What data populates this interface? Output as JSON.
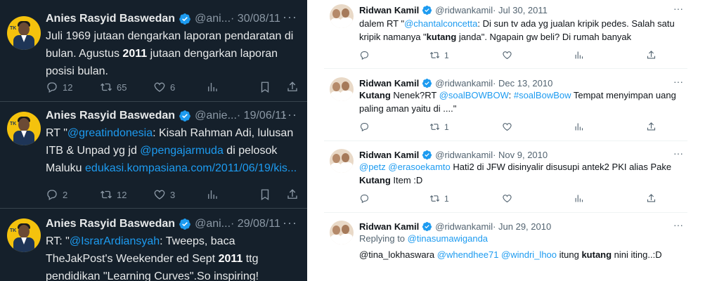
{
  "colors": {
    "dark_bg": "#15202b",
    "light_bg": "#ffffff",
    "link": "#1d9bf0",
    "verified": "#1d9bf0"
  },
  "left": {
    "tweets": [
      {
        "name": "Anies Rasyid Baswedan",
        "handle": "@ani...",
        "date": "· 30/08/11",
        "text": [
          {
            "t": "Juli 1969 jutaan dengarkan laporan pendaratan di bulan. Agustus "
          },
          {
            "t": "2011",
            "b": true
          },
          {
            "t": " jutaan dengarkan laporan posisi bulan."
          }
        ],
        "replies": "12",
        "retweets": "65",
        "likes": "6"
      },
      {
        "name": "Anies Rasyid Baswedan",
        "handle": "@anie...",
        "date": "· 19/06/11",
        "text": [
          {
            "t": "RT \""
          },
          {
            "t": "@greatindonesia",
            "l": true
          },
          {
            "t": ": Kisah Rahman Adi, lulusan ITB & Unpad yg jd "
          },
          {
            "t": "@pengajarmuda",
            "l": true
          },
          {
            "t": " di pelosok Maluku "
          },
          {
            "t": "edukasi.kompasiana.com/2011/06/19/kis...",
            "l": true
          }
        ],
        "replies": "2",
        "retweets": "12",
        "likes": "3"
      },
      {
        "name": "Anies Rasyid Baswedan",
        "handle": "@ani...",
        "date": "· 29/08/11",
        "text": [
          {
            "t": "RT: \""
          },
          {
            "t": "@IsrarArdiansyah",
            "l": true
          },
          {
            "t": ": Tweeps, baca TheJakPost's Weekender ed Sept "
          },
          {
            "t": "2011",
            "b": true
          },
          {
            "t": " ttg pendidikan \"Learning Curves\".So inspiring!"
          }
        ]
      }
    ]
  },
  "right": {
    "tweets": [
      {
        "name": "Ridwan Kamil",
        "handle": "@ridwankamil",
        "date": "· Jul 30, 2011",
        "text": [
          {
            "t": "dalem RT \""
          },
          {
            "t": "@chantalconcetta",
            "l": true
          },
          {
            "t": ": Di sun tv ada yg jualan kripik pedes. Salah satu kripik namanya \""
          },
          {
            "t": "kutang",
            "b": true
          },
          {
            "t": " janda\". Ngapain gw beli? Di rumah banyak"
          }
        ],
        "replies": "",
        "retweets": "1",
        "likes": ""
      },
      {
        "name": "Ridwan Kamil",
        "handle": "@ridwankamil",
        "date": "· Dec 13, 2010",
        "text": [
          {
            "t": "Kutang",
            "b": true
          },
          {
            "t": " Nenek?RT "
          },
          {
            "t": "@soalBOWBOW",
            "l": true
          },
          {
            "t": ": "
          },
          {
            "t": "#soalBowBow",
            "l": true
          },
          {
            "t": " Tempat menyimpan uang paling aman yaitu di ....\""
          }
        ],
        "replies": "",
        "retweets": "1",
        "likes": ""
      },
      {
        "name": "Ridwan Kamil",
        "handle": "@ridwankamil",
        "date": "· Nov 9, 2010",
        "text": [
          {
            "t": "@petz",
            "l": true
          },
          {
            "t": " "
          },
          {
            "t": "@erasoekamto",
            "l": true
          },
          {
            "t": " Hati2 di JFW disinyalir disusupi antek2 PKI alias Pake "
          },
          {
            "t": "Kutang",
            "b": true
          },
          {
            "t": " Item :D"
          }
        ],
        "replies": "",
        "retweets": "1",
        "likes": ""
      },
      {
        "name": "Ridwan Kamil",
        "handle": "@ridwankamil",
        "date": "· Jun 29, 2010",
        "reply_to_prefix": "Replying to ",
        "reply_to": "@tinasumawiganda",
        "text": [
          {
            "t": "@tina_lokhaswara "
          },
          {
            "t": "@whendhee71",
            "l": true
          },
          {
            "t": " "
          },
          {
            "t": "@windri_lhoo",
            "l": true
          },
          {
            "t": " itung "
          },
          {
            "t": "kutang",
            "b": true
          },
          {
            "t": " nini iting..:D"
          }
        ]
      }
    ]
  },
  "icons": {
    "more": "more-icon",
    "reply": "reply-icon",
    "retweet": "retweet-icon",
    "like": "like-icon",
    "views": "views-icon",
    "bookmark": "bookmark-icon",
    "share": "share-icon",
    "verified": "verified-badge-icon"
  },
  "more_glyph": "···"
}
